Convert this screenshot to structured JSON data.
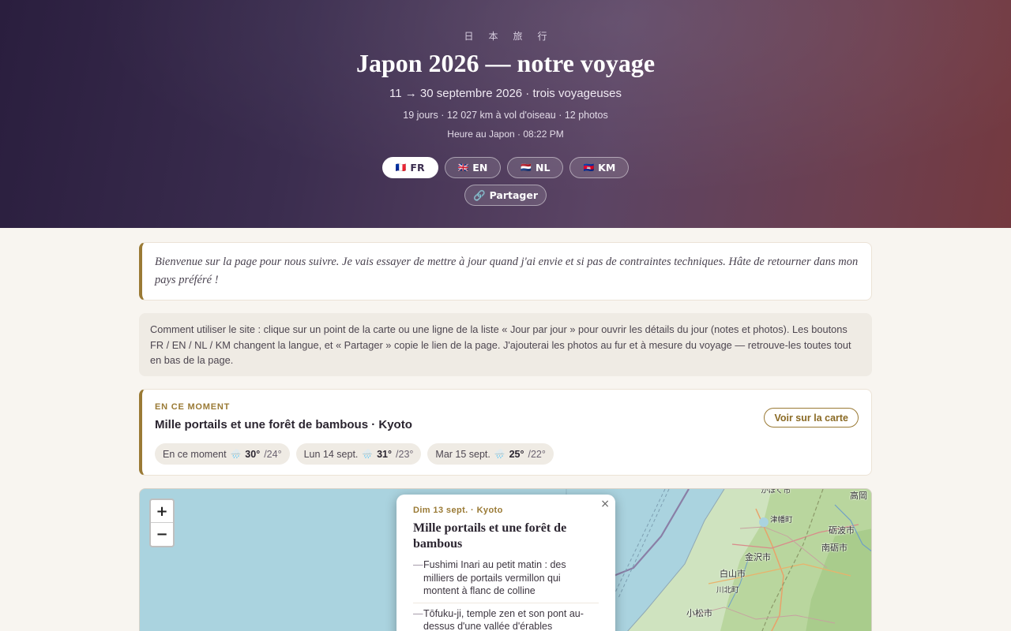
{
  "hero": {
    "kanji": "日本旅行",
    "title": "Japon 2026 — notre voyage",
    "subtitle": "11 → 30 septembre 2026 · trois voyageuses",
    "stats": "19 jours · 12 027 km à vol d'oiseau · 12 photos",
    "clock": "Heure au Japon · 08:22 PM",
    "languages": [
      {
        "flag": "🇫🇷",
        "label": "FR",
        "active": true
      },
      {
        "flag": "🇬🇧",
        "label": "EN",
        "active": false
      },
      {
        "flag": "🇳🇱",
        "label": "NL",
        "active": false
      },
      {
        "flag": "🇰🇭",
        "label": "KM",
        "active": false
      }
    ],
    "share": {
      "icon": "🔗",
      "label": "Partager"
    }
  },
  "welcome": "Bienvenue sur la page pour nous suivre. Je vais essayer de mettre à jour quand j'ai envie et si pas de contraintes techniques. Hâte de retourner dans mon pays préféré !",
  "howto": "Comment utiliser le site : clique sur un point de la carte ou une ligne de la liste « Jour par jour » pour ouvrir les détails du jour (notes et photos). Les boutons FR / EN / NL / KM changent la langue, et « Partager » copie le lien de la page. J'ajouterai les photos au fur et à mesure du voyage — retrouve-les toutes tout en bas de la page.",
  "now": {
    "kicker": "EN CE MOMENT",
    "title": "Mille portails et une forêt de bambous · Kyoto",
    "map_link": "Voir sur la carte",
    "weather": [
      {
        "label": "En ce moment",
        "icon": "🌧️",
        "hi": "30°",
        "lo": "/24°"
      },
      {
        "label": "Lun 14 sept.",
        "icon": "🌧️",
        "hi": "31°",
        "lo": "/23°"
      },
      {
        "label": "Mar 15 sept.",
        "icon": "🌧️",
        "hi": "25°",
        "lo": "/22°"
      }
    ]
  },
  "map": {
    "zoom_in": "+",
    "zoom_out": "−",
    "labels": [
      "かほく市",
      "高岡",
      "津幡町",
      "砺波市",
      "金沢市",
      "南砺市",
      "白山市",
      "川北町",
      "小松市"
    ],
    "popup": {
      "close": "×",
      "date": "Dim 13 sept. · Kyoto",
      "title": "Mille portails et une forêt de bambous",
      "items": [
        "Fushimi Inari au petit matin : des milliers de portails vermillon qui montent à flanc de colline",
        "Tōfuku-ji, temple zen et son pont au-dessus d'une vallée d'érables"
      ]
    }
  }
}
